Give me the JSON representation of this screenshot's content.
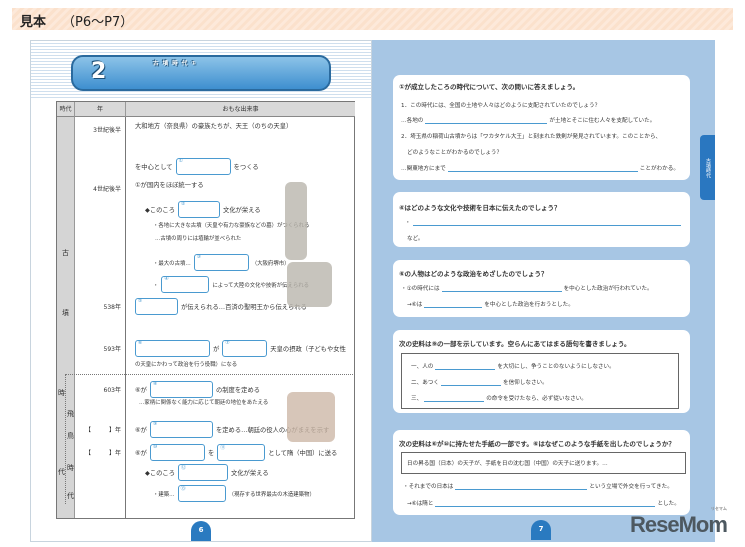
{
  "header": {
    "label": "見本",
    "pages": "（P6〜P7）"
  },
  "left": {
    "title_num": "2",
    "title": "古墳時代①",
    "page_number": "6",
    "headers": {
      "era": "時代",
      "year": "年",
      "events": "おもな出来事"
    },
    "eras": [
      "古",
      "墳",
      "時",
      "代"
    ],
    "sub_era": [
      "飛",
      "鳥",
      "時",
      "代"
    ],
    "rows": [
      {
        "year": "3世紀後半",
        "parts": [
          "大和地方（奈良県）の豪族たちが、天王（のちの天皇）"
        ]
      },
      {
        "year": "",
        "parts": [
          "を中心として",
          {
            "box": "①"
          },
          "をつくる"
        ]
      },
      {
        "year": "4世紀後半",
        "parts": [
          "①が国内をほぼ統一する"
        ]
      },
      {
        "year": "",
        "parts": [
          "◆このころ",
          {
            "box": "②"
          },
          "文化が栄える"
        ]
      },
      {
        "year": "",
        "small": true,
        "parts": [
          "・各地に大きな古墳（天皇や有力な豪族などの墓）がつくられる"
        ]
      },
      {
        "year": "",
        "small": true,
        "parts": [
          "…古墳の周りには埴輪が並べられた"
        ]
      },
      {
        "year": "",
        "small": true,
        "parts": [
          "・最大の古墳…",
          {
            "box": "③"
          },
          "（大阪府堺市）"
        ]
      },
      {
        "year": "",
        "small": true,
        "parts": [
          "・",
          {
            "box": "④"
          },
          "によって大陸の文化や技術が伝えられる"
        ]
      },
      {
        "year": "538年",
        "parts": [
          {
            "box": "⑤"
          },
          "が伝えられる…百済の聖明王から伝えられる"
        ]
      },
      {
        "year": "593年",
        "parts": [
          {
            "box": "⑥"
          },
          "が",
          {
            "box": "⑦"
          },
          "天皇の摂政（子どもや女性"
        ]
      },
      {
        "year": "",
        "small": true,
        "parts": [
          "の天皇にかわって政治を行う役職）になる"
        ]
      },
      {
        "year": "603年",
        "parts": [
          "⑥が",
          {
            "box": "⑧"
          },
          "の制度を定める"
        ]
      },
      {
        "year": "",
        "small": true,
        "parts": [
          "…家柄に関係なく能力に応じて朝廷の地位をあたえる"
        ]
      },
      {
        "year": "【　　　】年",
        "parts": [
          "⑥が",
          {
            "box": "⑨"
          },
          "を定める…朝廷の役人の心がまえを示す"
        ]
      },
      {
        "year": "【　　　】年",
        "parts": [
          "⑥が",
          {
            "box": "⑩"
          },
          "を",
          {
            "box": "⑪"
          },
          "として隋（中国）に送る"
        ]
      },
      {
        "year": "",
        "parts": [
          "◆このころ",
          {
            "box": "⑫"
          },
          "文化が栄える"
        ]
      },
      {
        "year": "",
        "small": true,
        "parts": [
          "・建築…",
          {
            "box": "⑬"
          },
          "（現存する世界最古の木造建築物）"
        ]
      }
    ]
  },
  "right": {
    "tab": "古墳時代",
    "page_number": "7",
    "q1": {
      "title": "①が成立したころの時代について、次の問いに答えましょう。",
      "l1": "1．この時代には、全国の土地や人々はどのように支配されていたのでしょう？",
      "l2a": "…各地の",
      "l2b": "が土地とそこに住む人々を支配していた。",
      "l3": "2．埼玉県の稲荷山古墳からは「ワカタケル大王」と刻まれた鉄剣が発見されています。このことから、",
      "l4": "どのようなことがわかるのでしょう？",
      "l5a": "…関東地方にまで",
      "l5b": "ことがわかる。"
    },
    "q2": {
      "title": "④はどのような文化や技術を日本に伝えたのでしょう？",
      "l1": "・",
      "l2": "など。"
    },
    "q3": {
      "title": "⑥の人物はどのような政治をめざしたのでしょう？",
      "l1a": "・①の時代には",
      "l1b": "を中心とした政治が行われていた。",
      "l2a": "→⑥は",
      "l2b": "を中心とした政治を行おうとした。"
    },
    "q4": {
      "title": "次の史料は⑨の一部を示しています。空らんにあてはまる語句を書きましょう。",
      "l1a": "一、人の",
      "l1b": "を大切にし、争うことのないようにしなさい。",
      "l2a": "二、あつく",
      "l2b": "を信仰しなさい。",
      "l3a": "三、",
      "l3b": "の命令を受けたなら、必ず従いなさい。"
    },
    "q5": {
      "title": "次の史料は⑥が⑩に持たせた手紙の一部です。⑥はなぜこのような手紙を出したのでしょうか？",
      "quote": "日の昇る国（日本）の天子が、手紙を日の沈む国（中国）の天子に送ります。…",
      "l1a": "・それまでの日本は",
      "l1b": "という立場で外交を行ってきた。",
      "l2a": "→⑥は隋と",
      "l2b": "とした。"
    }
  },
  "logo": {
    "text": "ReseMom",
    "ruby": "リセマム"
  }
}
